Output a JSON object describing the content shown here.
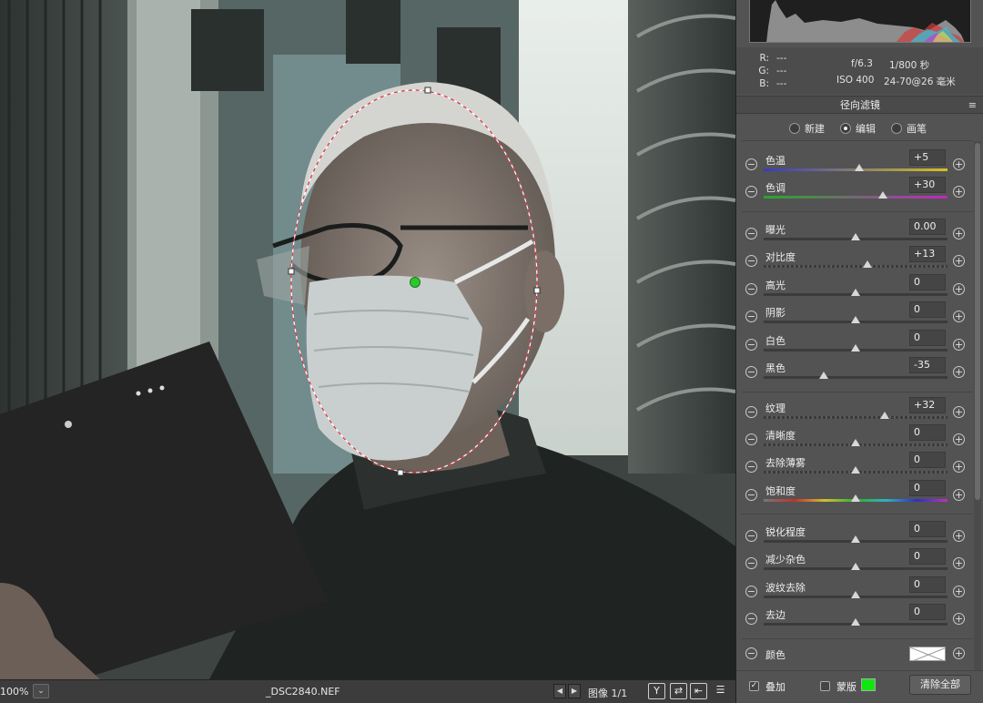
{
  "status_bar": {
    "zoom": "100%",
    "zoom_dropdown": "⌄",
    "filename": "_DSC2840.NEF",
    "prev_image": "◀",
    "next_image": "▶",
    "image_counter": "图像 1/1",
    "icons": [
      "Y",
      "⇄",
      "⇤",
      "☰"
    ]
  },
  "info": {
    "r_label": "R:",
    "r_value": "---",
    "g_label": "G:",
    "g_value": "---",
    "b_label": "B:",
    "b_value": "---",
    "aperture": "f/6.3",
    "shutter": "1/800 秒",
    "iso": "ISO 400",
    "lens": "24-70@26 毫米"
  },
  "panel": {
    "title": "径向滤镜",
    "modes": [
      {
        "label": "新建",
        "selected": false
      },
      {
        "label": "编辑",
        "selected": true
      },
      {
        "label": "画笔",
        "selected": false
      }
    ]
  },
  "adjustments": {
    "temperature": {
      "label": "色温",
      "value": "+5",
      "pos": 0.52
    },
    "tint": {
      "label": "色调",
      "value": "+30",
      "pos": 0.65
    },
    "exposure": {
      "label": "曝光",
      "value": "0.00",
      "pos": 0.5
    },
    "contrast": {
      "label": "对比度",
      "value": "+13",
      "pos": 0.565
    },
    "highlights": {
      "label": "高光",
      "value": "0",
      "pos": 0.5
    },
    "shadows": {
      "label": "阴影",
      "value": "0",
      "pos": 0.5
    },
    "whites": {
      "label": "白色",
      "value": "0",
      "pos": 0.5
    },
    "blacks": {
      "label": "黑色",
      "value": "-35",
      "pos": 0.325
    },
    "texture": {
      "label": "纹理",
      "value": "+32",
      "pos": 0.66
    },
    "clarity": {
      "label": "清晰度",
      "value": "0",
      "pos": 0.5
    },
    "dehaze": {
      "label": "去除薄雾",
      "value": "0",
      "pos": 0.5
    },
    "saturation": {
      "label": "饱和度",
      "value": "0",
      "pos": 0.5
    },
    "sharpness": {
      "label": "锐化程度",
      "value": "0",
      "pos": 0.5
    },
    "noise": {
      "label": "减少杂色",
      "value": "0",
      "pos": 0.5
    },
    "moire": {
      "label": "波纹去除",
      "value": "0",
      "pos": 0.5
    },
    "defringe": {
      "label": "去边",
      "value": "0",
      "pos": 0.5
    },
    "color": {
      "label": "颜色"
    }
  },
  "bottom": {
    "overlay_label": "叠加",
    "overlay_checked": true,
    "mask_label": "蒙版",
    "mask_checked": false,
    "mask_color": "#11e611",
    "clear_all": "清除全部"
  }
}
